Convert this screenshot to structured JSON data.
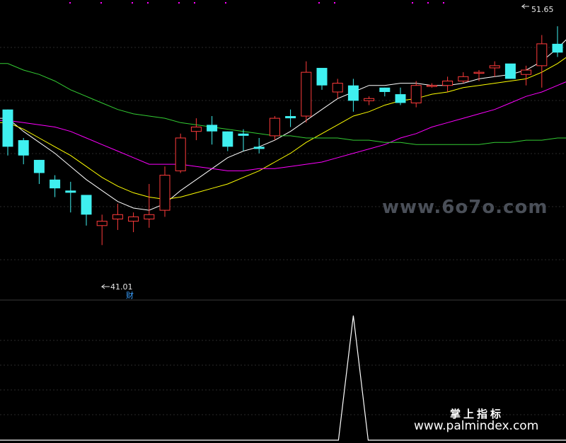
{
  "chart_data": [
    {
      "type": "candlestick",
      "price_range": [
        38.5,
        52.2
      ],
      "annotations": {
        "high_label": "51.65",
        "low_label": "41.01",
        "low_marker": "财"
      },
      "candles": [
        {
          "o": 47.2,
          "h": 47.2,
          "l": 45.1,
          "c": 45.5
        },
        {
          "o": 45.8,
          "h": 45.9,
          "l": 44.7,
          "c": 45.1
        },
        {
          "o": 44.9,
          "h": 44.9,
          "l": 43.8,
          "c": 44.3
        },
        {
          "o": 44.0,
          "h": 44.2,
          "l": 43.2,
          "c": 43.6
        },
        {
          "o": 43.5,
          "h": 43.9,
          "l": 42.5,
          "c": 43.4
        },
        {
          "o": 43.3,
          "h": 43.3,
          "l": 41.9,
          "c": 42.4
        },
        {
          "o": 41.9,
          "h": 42.4,
          "l": 41.01,
          "c": 42.1
        },
        {
          "o": 42.2,
          "h": 42.9,
          "l": 41.7,
          "c": 42.4
        },
        {
          "o": 42.1,
          "h": 42.5,
          "l": 41.6,
          "c": 42.3
        },
        {
          "o": 42.2,
          "h": 43.8,
          "l": 41.8,
          "c": 42.4
        },
        {
          "o": 42.6,
          "h": 44.6,
          "l": 42.3,
          "c": 44.2
        },
        {
          "o": 44.4,
          "h": 46.1,
          "l": 44.3,
          "c": 45.9
        },
        {
          "o": 46.2,
          "h": 46.8,
          "l": 45.8,
          "c": 46.4
        },
        {
          "o": 46.5,
          "h": 46.9,
          "l": 45.6,
          "c": 46.2
        },
        {
          "o": 46.2,
          "h": 46.2,
          "l": 45.3,
          "c": 45.5
        },
        {
          "o": 46.1,
          "h": 46.3,
          "l": 45.3,
          "c": 46.0
        },
        {
          "o": 45.5,
          "h": 45.9,
          "l": 45.2,
          "c": 45.4
        },
        {
          "o": 46.0,
          "h": 46.9,
          "l": 45.8,
          "c": 46.8
        },
        {
          "o": 46.9,
          "h": 47.2,
          "l": 46.4,
          "c": 46.8
        },
        {
          "o": 46.9,
          "h": 49.4,
          "l": 46.6,
          "c": 48.9
        },
        {
          "o": 49.1,
          "h": 49.1,
          "l": 48.1,
          "c": 48.3
        },
        {
          "o": 48.0,
          "h": 48.6,
          "l": 47.7,
          "c": 48.4
        },
        {
          "o": 48.3,
          "h": 48.6,
          "l": 47.1,
          "c": 47.6
        },
        {
          "o": 47.6,
          "h": 47.8,
          "l": 47.4,
          "c": 47.7
        },
        {
          "o": 48.2,
          "h": 48.2,
          "l": 47.8,
          "c": 48.0
        },
        {
          "o": 47.9,
          "h": 48.2,
          "l": 47.4,
          "c": 47.5
        },
        {
          "o": 47.5,
          "h": 48.5,
          "l": 47.3,
          "c": 48.3
        },
        {
          "o": 48.3,
          "h": 48.4,
          "l": 48.2,
          "c": 48.3
        },
        {
          "o": 48.3,
          "h": 48.7,
          "l": 48.0,
          "c": 48.5
        },
        {
          "o": 48.5,
          "h": 48.9,
          "l": 48.4,
          "c": 48.7
        },
        {
          "o": 48.9,
          "h": 49.0,
          "l": 48.5,
          "c": 48.9
        },
        {
          "o": 49.1,
          "h": 49.4,
          "l": 48.7,
          "c": 49.2
        },
        {
          "o": 49.3,
          "h": 49.2,
          "l": 48.6,
          "c": 48.6
        },
        {
          "o": 48.8,
          "h": 49.2,
          "l": 48.3,
          "c": 49.0
        },
        {
          "o": 49.2,
          "h": 50.6,
          "l": 48.2,
          "c": 50.2
        },
        {
          "o": 50.2,
          "h": 51.0,
          "l": 49.6,
          "c": 49.8
        },
        {
          "o": 49.6,
          "h": 51.65,
          "l": 49.5,
          "c": 51.5
        }
      ],
      "moving_averages": [
        {
          "color": "#ffffff",
          "values": [
            46.8,
            46.2,
            45.7,
            45.2,
            44.6,
            44.0,
            43.5,
            43.0,
            42.7,
            42.6,
            42.9,
            43.5,
            44.0,
            44.5,
            45.0,
            45.3,
            45.5,
            45.8,
            46.2,
            46.7,
            47.2,
            47.7,
            48.0,
            48.3,
            48.3,
            48.4,
            48.4,
            48.3,
            48.3,
            48.4,
            48.6,
            48.7,
            48.8,
            49.0,
            49.4,
            50.0,
            50.7
          ]
        },
        {
          "color": "#ffff00",
          "values": [
            46.6,
            46.3,
            45.9,
            45.5,
            45.1,
            44.6,
            44.1,
            43.7,
            43.4,
            43.2,
            43.1,
            43.2,
            43.4,
            43.6,
            43.8,
            44.1,
            44.4,
            44.8,
            45.2,
            45.7,
            46.1,
            46.5,
            46.9,
            47.1,
            47.4,
            47.6,
            47.7,
            47.9,
            48.0,
            48.2,
            48.3,
            48.4,
            48.5,
            48.6,
            48.9,
            49.3,
            49.8
          ]
        },
        {
          "color": "#ff00ff",
          "values": [
            46.7,
            46.6,
            46.5,
            46.4,
            46.2,
            45.9,
            45.6,
            45.3,
            45.0,
            44.7,
            44.7,
            44.7,
            44.6,
            44.5,
            44.4,
            44.4,
            44.5,
            44.5,
            44.6,
            44.7,
            44.8,
            45.0,
            45.2,
            45.4,
            45.6,
            45.9,
            46.1,
            46.4,
            46.6,
            46.8,
            47.0,
            47.2,
            47.5,
            47.8,
            48.0,
            48.3,
            48.6
          ]
        },
        {
          "color": "#33cc33",
          "values": [
            49.3,
            49.0,
            48.8,
            48.5,
            48.1,
            47.8,
            47.5,
            47.2,
            47.0,
            46.9,
            46.8,
            46.6,
            46.5,
            46.4,
            46.3,
            46.2,
            46.1,
            46.0,
            46.0,
            45.9,
            45.9,
            45.9,
            45.8,
            45.8,
            45.7,
            45.7,
            45.6,
            45.6,
            45.6,
            45.6,
            45.6,
            45.7,
            45.7,
            45.8,
            45.8,
            45.9,
            45.9
          ]
        }
      ]
    },
    {
      "type": "line",
      "values": [
        0,
        0,
        0,
        0,
        0,
        0,
        0,
        0,
        0,
        0,
        0,
        0,
        0,
        0,
        0,
        0,
        0,
        0,
        0,
        0,
        0,
        0,
        1,
        0,
        0,
        0,
        0,
        0,
        0,
        0,
        0,
        0,
        0,
        0,
        0,
        0,
        0
      ],
      "ylim": [
        0,
        1
      ],
      "color": "#ffffff"
    }
  ],
  "watermarks": {
    "site_gray": "www.6o7o.com",
    "brand": "掌上指标",
    "site": "www.palmindex.com"
  },
  "colors": {
    "up": "#ff3b3b",
    "down": "#3ff0f0",
    "grid": "#2a2a2a"
  }
}
